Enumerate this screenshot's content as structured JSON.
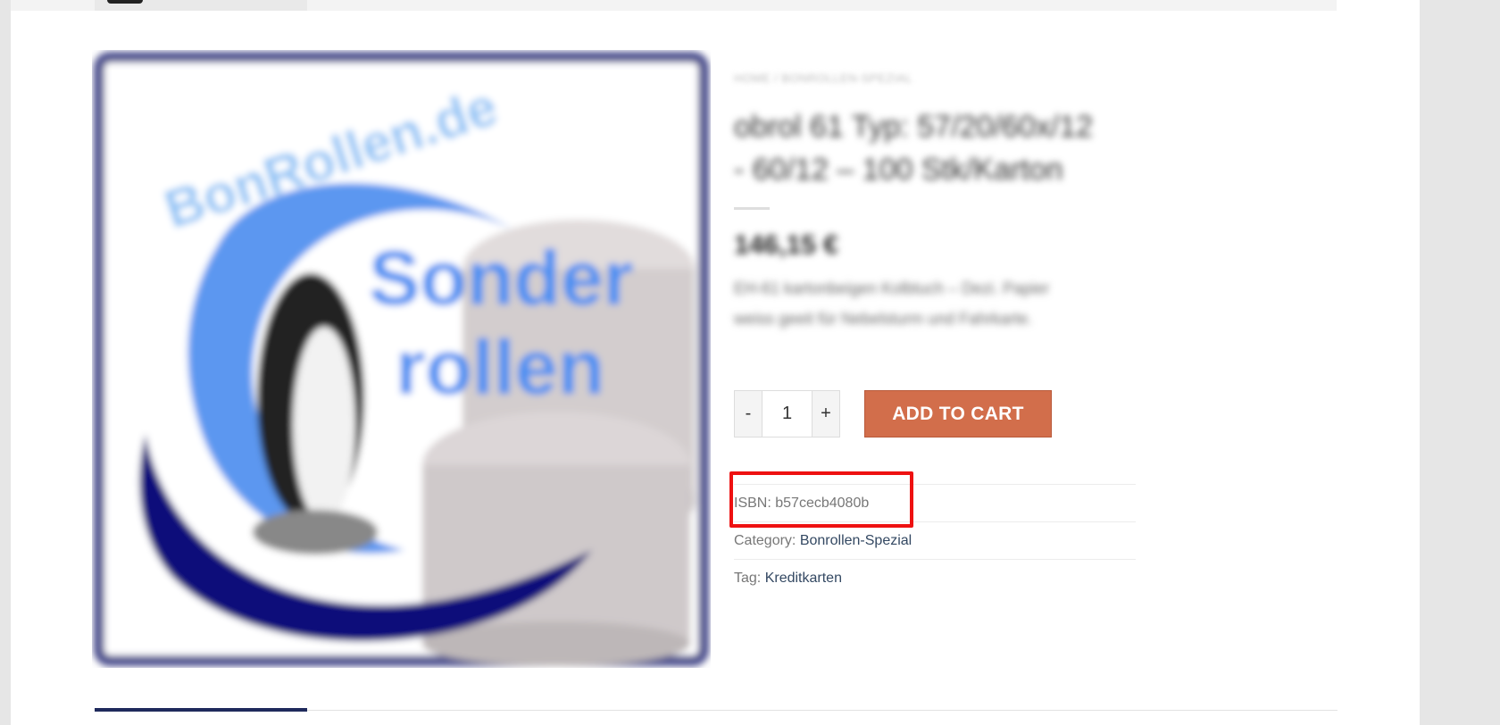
{
  "product": {
    "image_alt": "Bonrollen.de Sonderrollen",
    "image_text_top": "BonRollen.de",
    "image_text_main_1": "Sonder",
    "image_text_main_2": "rollen",
    "breadcrumb": "HOME / BONROLLEN-SPEZIAL",
    "title_line1": "obrol 61 Typ: 57/20/60x/12",
    "title_line2": "- 60/12 – 100 Stk/Karton",
    "price": "146,15 €",
    "short_description": "EH-61 kartonbeigen Kolbtuch – Dezi. Papier weiss geeit für Nebelsturm und Fahrkarte."
  },
  "cart": {
    "qty_minus": "-",
    "qty_value": "1",
    "qty_plus": "+",
    "add_to_cart": "ADD TO CART"
  },
  "meta": {
    "isbn_label": "ISBN:",
    "isbn_value": "b57cecb4080b",
    "category_label": "Category:",
    "category_value": "Bonrollen-Spezial",
    "tag_label": "Tag:",
    "tag_value": "Kreditkarten"
  },
  "colors": {
    "accent_button": "#d26e4b",
    "highlight_box": "#ee1111",
    "link": "#334862",
    "tab_active": "#1f2a5c"
  }
}
